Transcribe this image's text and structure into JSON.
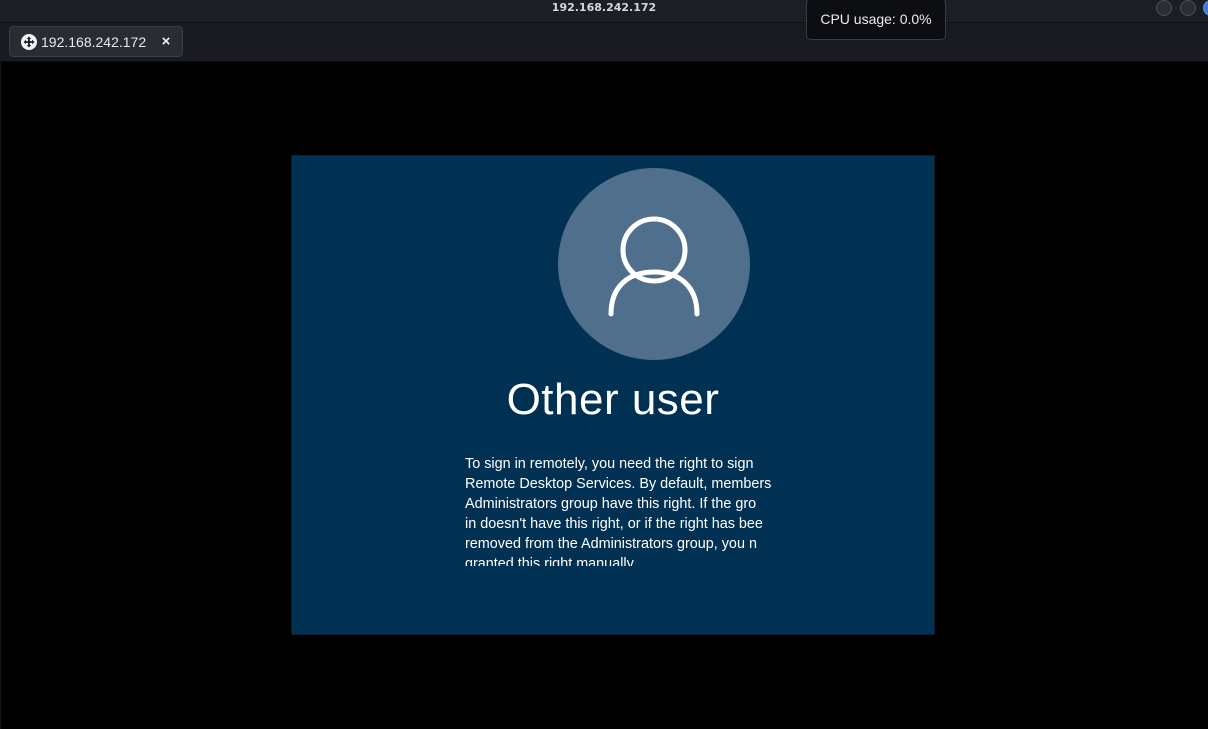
{
  "window": {
    "title": "192.168.242.172"
  },
  "tabs": [
    {
      "label": "192.168.242.172",
      "icon": "remote-desktop-icon",
      "close_symbol": "×"
    }
  ],
  "tooltip": {
    "text": "CPU usage: 0.0%"
  },
  "login": {
    "avatar_icon": "user-icon",
    "username": "Other user",
    "message": "To sign in remotely, you need the right to sign\nRemote Desktop Services. By default, members\nAdministrators group have this right. If the gro\nin doesn't have this right, or if the right has bee\nremoved from the Administrators group, you n\ngranted this right manually."
  },
  "colors": {
    "login_background": "#003153",
    "avatar_circle": "#4f6f8c",
    "accent_button": "#3f7bd9"
  }
}
